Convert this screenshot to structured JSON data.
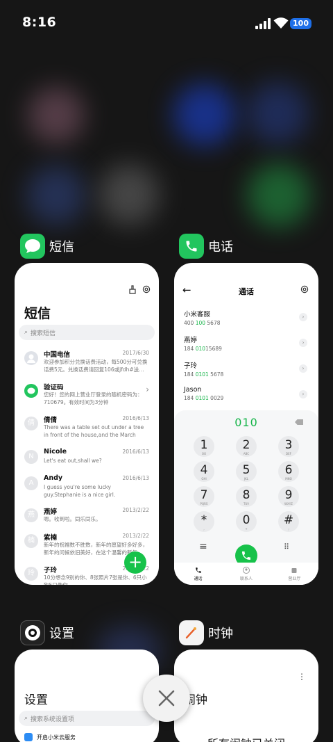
{
  "status": {
    "time": "8:16",
    "battery": "100"
  },
  "apps": [
    {
      "name": "短信",
      "icon": "messages-icon"
    },
    {
      "name": "电话",
      "icon": "phone-icon"
    },
    {
      "name": "设置",
      "icon": "settings-icon"
    },
    {
      "name": "时钟",
      "icon": "clock-icon"
    }
  ],
  "sms": {
    "title": "短信",
    "search_placeholder": "搜索短信",
    "messages": [
      {
        "avatar": "",
        "name": "中国电信",
        "date": "2017/6/30",
        "preview": "欢迎参加积分兑换话费活动，每500分可兑换话费5元。兑换话费请回复106或jfdh#送…"
      },
      {
        "avatar": "",
        "name": "验证码",
        "date": "",
        "preview": "您好！您的网上营业厅登录的随机密码为：710679。有效时间为3分钟"
      },
      {
        "avatar": "倩",
        "name": "倩倩",
        "date": "2016/6/13",
        "preview": "There was a table set out under a tree in front of the house,and the March Hare an…"
      },
      {
        "avatar": "N",
        "name": "Nicole",
        "date": "2016/6/13",
        "preview": "Let's eat out,shall we?"
      },
      {
        "avatar": "A",
        "name": "Andy",
        "date": "2016/6/13",
        "preview": "I guess you're some lucky guy.Stephanie is a nice girl."
      },
      {
        "avatar": "燕",
        "name": "燕婷",
        "date": "2013/2/22",
        "preview": "嗯。收到啦。同乐同乐。"
      },
      {
        "avatar": "楠",
        "name": "紫楠",
        "date": "2013/2/22",
        "preview": "新年的祝福数不胜数，新年的愿望好多好多，新年的问候依旧美好，在这个温馨的新年…"
      },
      {
        "avatar": "玲",
        "name": "子玲",
        "date": "2013/2/22",
        "preview": "10分想念9别的你、8张照片7张是你、6只小狗5只像你…"
      }
    ]
  },
  "phone": {
    "title": "通话",
    "contacts": [
      {
        "name": "小米客服",
        "num_pre": "400 ",
        "num_hl": "100",
        "num_post": " 5678"
      },
      {
        "name": "燕婷",
        "num_pre": "184 ",
        "num_hl": "010",
        "num_post": "15689"
      },
      {
        "name": "子玲",
        "num_pre": "184 ",
        "num_hl": "0101",
        "num_post": " 5678"
      },
      {
        "name": "Jason",
        "num_pre": "184 ",
        "num_hl": "0101",
        "num_post": " 0029"
      }
    ],
    "dialed": "010",
    "keys": [
      {
        "d": "1",
        "l": "OO"
      },
      {
        "d": "2",
        "l": "ABC"
      },
      {
        "d": "3",
        "l": "DEF"
      },
      {
        "d": "4",
        "l": "GHI"
      },
      {
        "d": "5",
        "l": "JKL"
      },
      {
        "d": "6",
        "l": "MNO"
      },
      {
        "d": "7",
        "l": "PQRS"
      },
      {
        "d": "8",
        "l": "TUV"
      },
      {
        "d": "9",
        "l": "WXYZ"
      },
      {
        "d": "*",
        "l": ","
      },
      {
        "d": "0",
        "l": "+"
      },
      {
        "d": "#",
        "l": ";"
      }
    ],
    "tabs": [
      "通话",
      "联系人",
      "营业厅"
    ]
  },
  "settings": {
    "title": "设置",
    "search_placeholder": "搜索系统设置项",
    "first_item": "开启小米云服务"
  },
  "clock": {
    "title": "闹钟",
    "empty": "所有闹钟已关闭"
  },
  "colors": {
    "accent": "#17c24a",
    "background": "#161616"
  }
}
